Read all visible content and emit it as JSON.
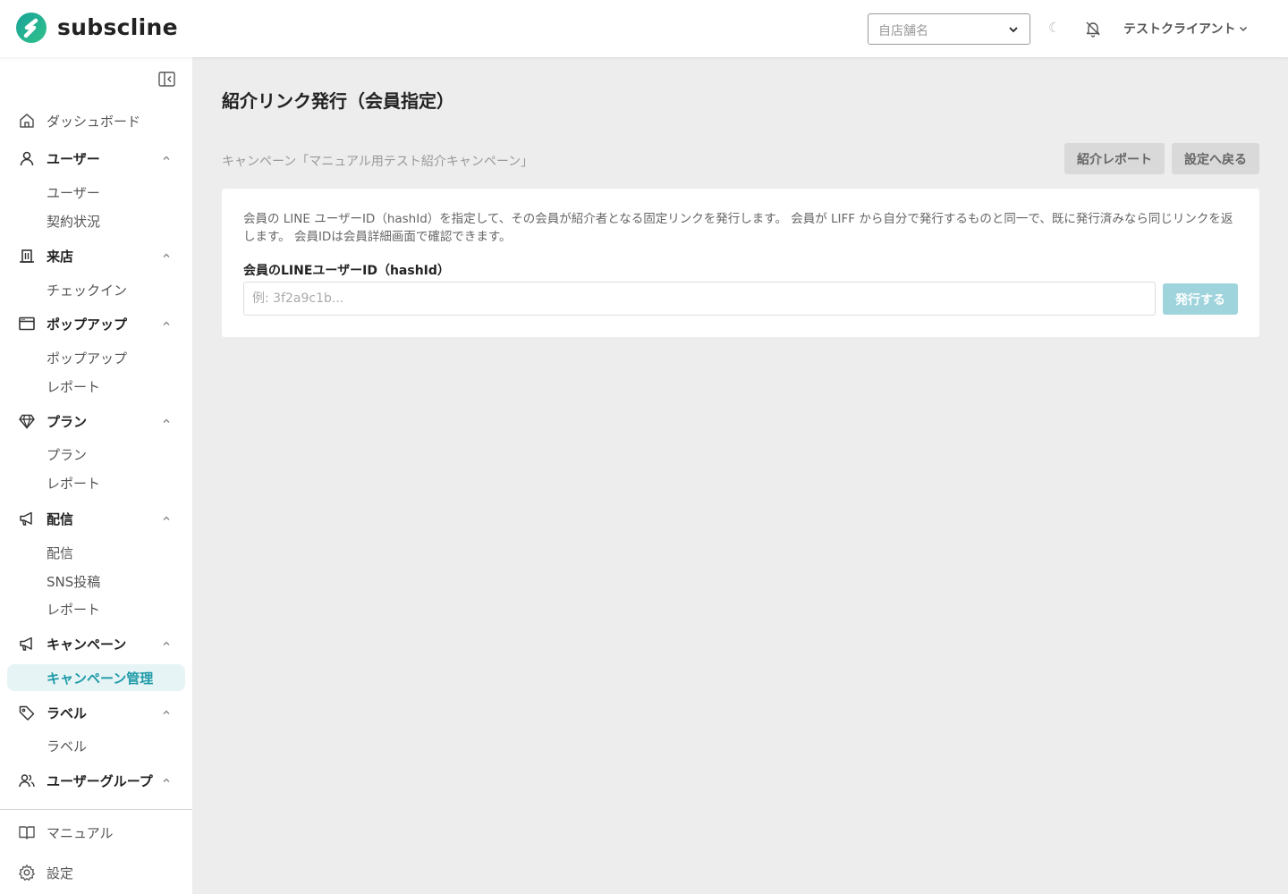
{
  "header": {
    "logo_text": "subscline",
    "store_select_placeholder": "自店舗名",
    "user_menu_label": "テストクライアント",
    "brand_color": "#1e9aa8"
  },
  "sidebar": {
    "sections": {
      "dashboard": "ダッシュボード",
      "users": "ユーザー",
      "visit": "来店",
      "popup": "ポップアップ",
      "plan": "プラン",
      "delivery": "配信",
      "campaign": "キャンペーン",
      "label": "ラベル",
      "usergroup": "ユーザーグループ"
    },
    "sub": {
      "users_user": "ユーザー",
      "users_contract": "契約状況",
      "visit_checkin": "チェックイン",
      "popup_popup": "ポップアップ",
      "popup_report": "レポート",
      "plan_plan": "プラン",
      "plan_report": "レポート",
      "delivery_delivery": "配信",
      "delivery_sns": "SNS投稿",
      "delivery_report": "レポート",
      "campaign_manage": "キャンペーン管理",
      "label_label": "ラベル"
    },
    "footer": {
      "manual": "マニュアル",
      "settings": "設定"
    }
  },
  "main": {
    "page_title": "紹介リンク発行（会員指定）",
    "campaign_line": "キャンペーン「マニュアル用テスト紹介キャンペーン」",
    "report_button": "紹介レポート",
    "back_button": "設定へ戻る",
    "description": "会員の LINE ユーザーID（hashId）を指定して、その会員が紹介者となる固定リンクを発行します。 会員が LIFF から自分で発行するものと同一で、既に発行済みなら同じリンクを返します。 会員IDは会員詳細画面で確認できます。",
    "field_label": "会員のLINEユーザーID（hashId）",
    "field_placeholder": "例: 3f2a9c1b...",
    "issue_button": "発行する"
  }
}
